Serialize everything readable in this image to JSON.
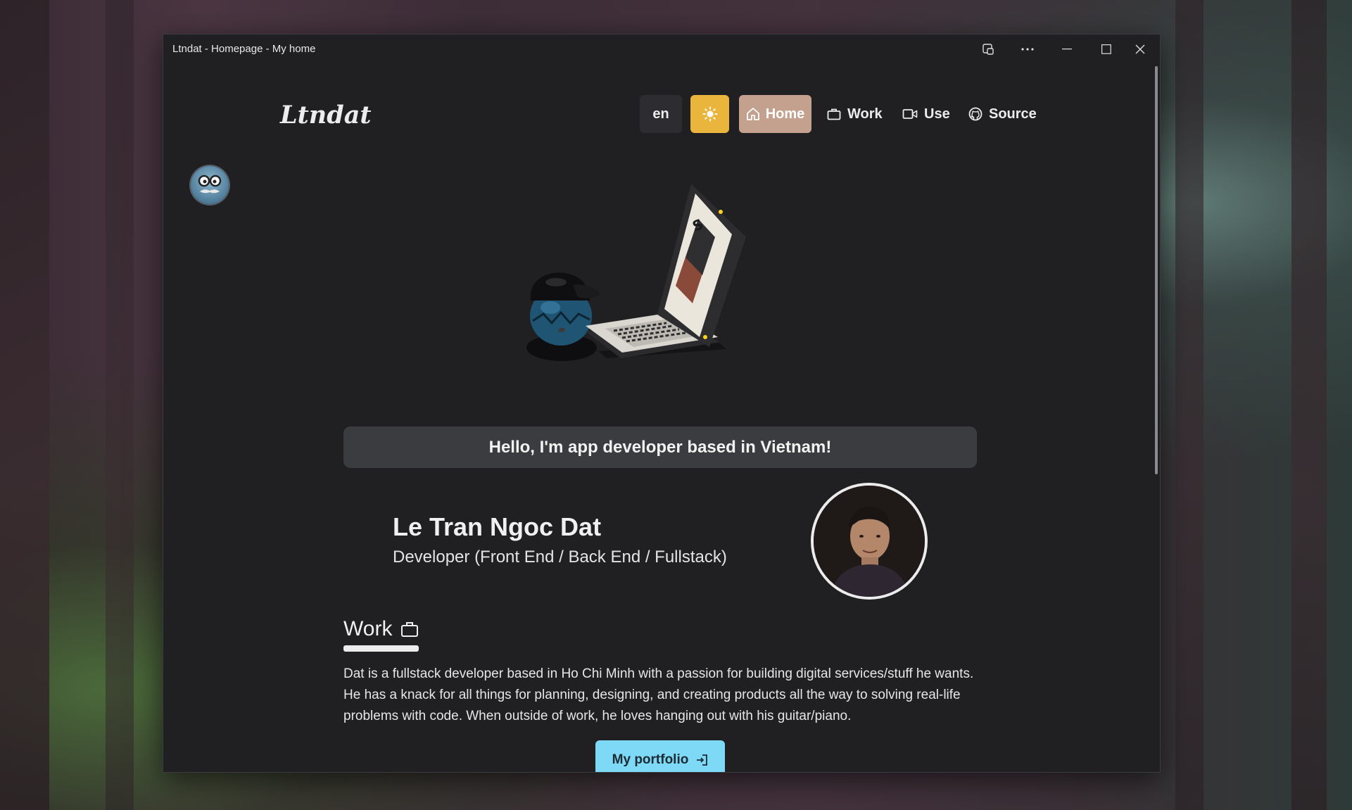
{
  "window": {
    "title": "Ltndat - Homepage - My home"
  },
  "site": {
    "logo": "Ltndat",
    "nav": {
      "lang": "en",
      "theme_icon": "sun-icon",
      "home": "Home",
      "work": "Work",
      "use": "Use",
      "source": "Source"
    }
  },
  "hero": {
    "greeting": "Hello, I'm app developer based in Vietnam!",
    "name": "Le Tran Ngoc Dat",
    "role": "Developer (Front End / Back End / Fullstack)"
  },
  "work_section": {
    "title": "Work",
    "paragraph": "Dat is a fullstack developer based in Ho Chi Minh with a passion for building digital services/stuff he wants. He has a knack for all things for planning, designing, and creating products all the way to solving real-life problems with code. When outside of work, he loves hanging out with his guitar/piano.",
    "button": "My portfolio"
  },
  "colors": {
    "background": "#202023",
    "theme_button": "#eab53d",
    "home_button": "#c4a08e",
    "greeting_box": "#3a3c3f",
    "portfolio_button": "#7ed9f7"
  }
}
